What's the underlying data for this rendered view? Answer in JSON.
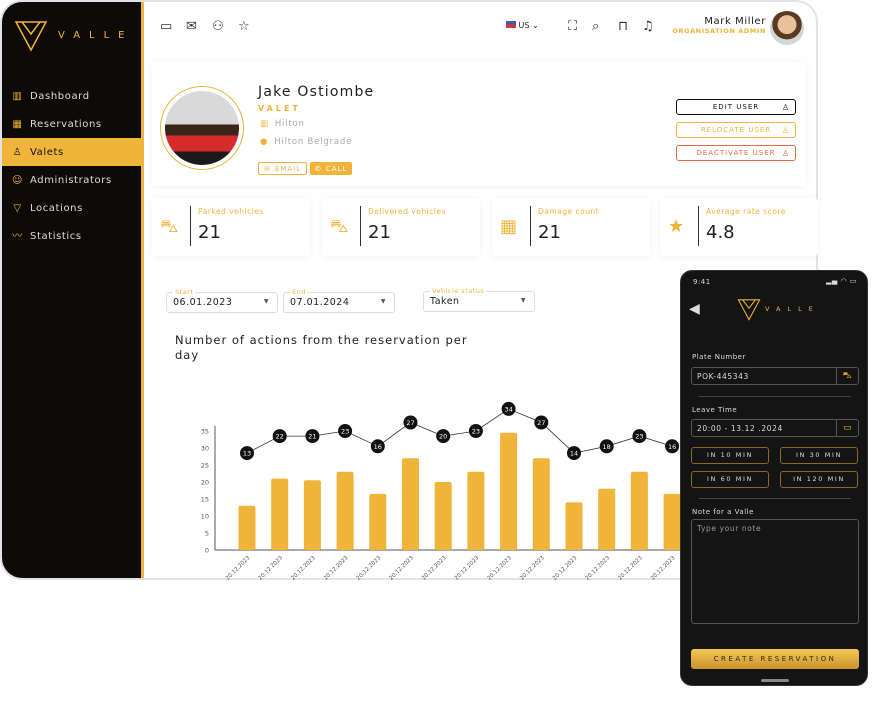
{
  "brand": {
    "name": "VALLE",
    "accent": "#f0b43a",
    "dark": "#0d0a07"
  },
  "sidebar": {
    "items": [
      {
        "label": "Dashboard",
        "icon": "dashboard-icon",
        "glyph": "▥"
      },
      {
        "label": "Reservations",
        "icon": "calendar-icon",
        "glyph": "▦"
      },
      {
        "label": "Valets",
        "icon": "valet-icon",
        "glyph": "♙",
        "active": true
      },
      {
        "label": "Administrators",
        "icon": "admin-icon",
        "glyph": "☺"
      },
      {
        "label": "Locations",
        "icon": "location-triangle-icon",
        "glyph": "▽"
      },
      {
        "label": "Statistics",
        "icon": "statistics-icon",
        "glyph": "〰"
      }
    ]
  },
  "topbar": {
    "language": "US",
    "user_name": "Mark Miller",
    "user_role": "ORGANISATION ADMIN"
  },
  "profile": {
    "name": "Jake Ostiombe",
    "role": "VALET",
    "company": "Hilton",
    "location": "Hilton Belgrade",
    "email_label": "EMAIL",
    "call_label": "CALL",
    "actions": {
      "edit": "EDIT USER",
      "relocate": "RELOCATE USER",
      "deactivate": "DEACTIVATE USER"
    }
  },
  "stats": [
    {
      "label": "Parked vehicles",
      "value": "21",
      "icon": "parked-car-icon"
    },
    {
      "label": "Delivered vehicles",
      "value": "21",
      "icon": "delivered-car-icon"
    },
    {
      "label": "Damage count",
      "value": "21",
      "icon": "damage-calendar-icon"
    },
    {
      "label": "Average rate score",
      "value": "4.8",
      "icon": "star-icon"
    }
  ],
  "filters": {
    "start": {
      "label": "Start",
      "value": "06.01.2023"
    },
    "end": {
      "label": "End",
      "value": "07.01.2024"
    },
    "status": {
      "label": "Vehicle status",
      "value": "Taken"
    }
  },
  "chart_data": {
    "type": "bar",
    "title": "Number of actions from the reservation per day",
    "categories": [
      "20.12.2023",
      "20.12.2023",
      "20.12.2023",
      "20.12.2023",
      "20.12.2023",
      "20.12.2023",
      "20.12.2023",
      "20.12.2023",
      "20.12.2023",
      "20.12.2023",
      "20.12.2023",
      "20.12.2023",
      "20.12.2023",
      "20.12.2023"
    ],
    "series": [
      {
        "type": "bar",
        "values": [
          13,
          21,
          20.5,
          23,
          16.5,
          27,
          20,
          23,
          34.5,
          27,
          14,
          18,
          23,
          16.5
        ],
        "color": "#f0b43a"
      },
      {
        "type": "line",
        "labels": [
          13,
          22,
          21,
          23,
          16,
          27,
          20,
          23,
          34,
          27,
          14,
          18,
          23,
          16
        ],
        "color": "#111"
      }
    ],
    "yticks": [
      0,
      5,
      10,
      15,
      20,
      25,
      30,
      35
    ],
    "ylim": [
      0,
      35
    ],
    "grid": false
  },
  "phone": {
    "time": "9:41",
    "brand": "VALLE",
    "plate_label": "Plate Number",
    "plate_value": "POK-445343",
    "leave_label": "Leave Time",
    "leave_value": "20:00 - 13.12 .2024",
    "quick": [
      "IN 10 MIN",
      "IN 30 MIN",
      "IN 60 MIN",
      "IN 120 MIN"
    ],
    "note_label": "Note for a Valle",
    "note_placeholder": "Type your note",
    "cta": "CREATE RESERVATION"
  }
}
